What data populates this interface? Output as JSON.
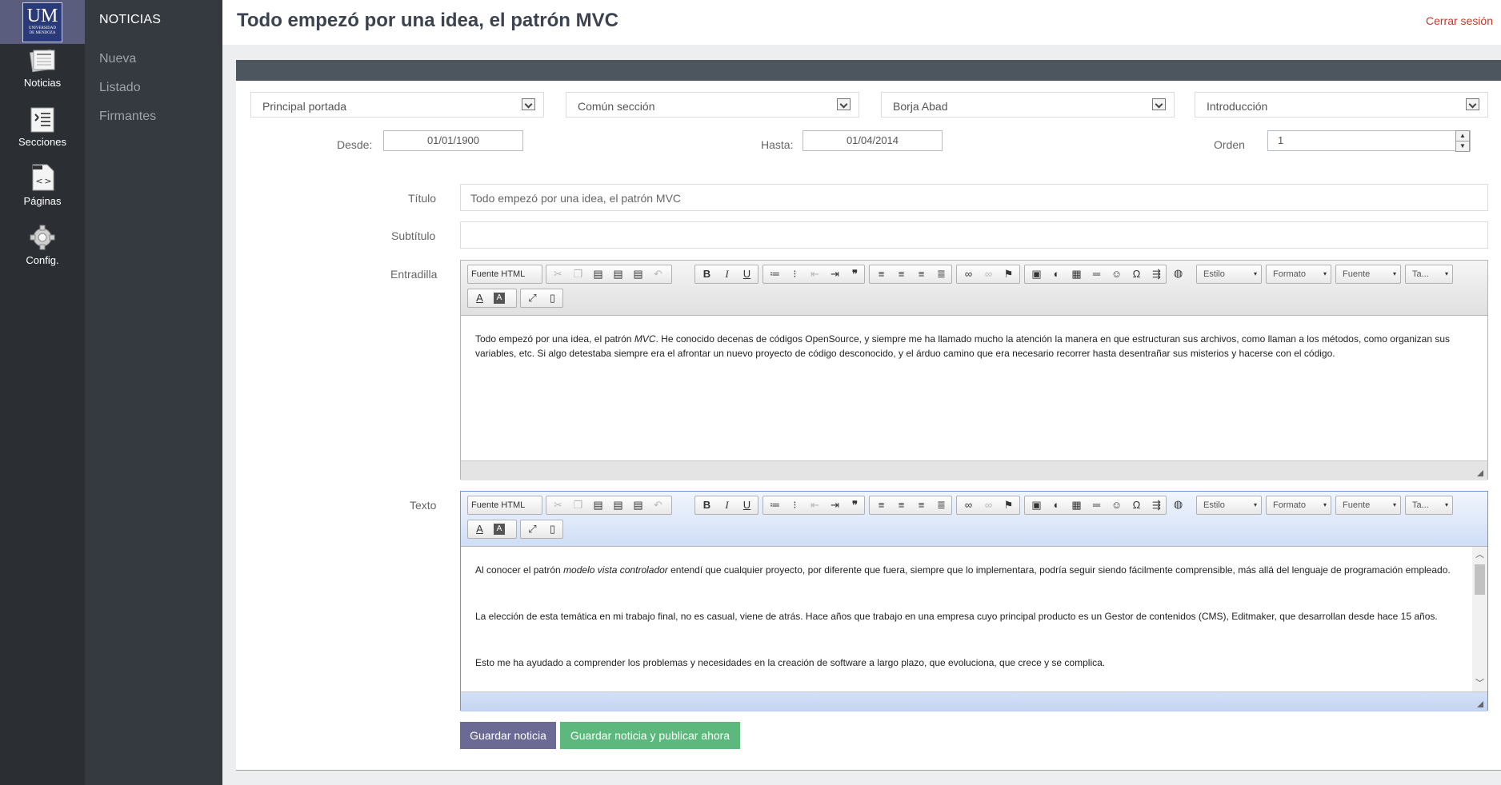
{
  "logo": {
    "big": "UM",
    "small1": "UNIVERSIDAD",
    "small2": "DE MENDOZA"
  },
  "nav": [
    {
      "label": "Noticias",
      "icon": "newspaper-icon"
    },
    {
      "label": "Secciones",
      "icon": "list-icon"
    },
    {
      "label": "Páginas",
      "icon": "html-page-icon"
    },
    {
      "label": "Config.",
      "icon": "gear-icon"
    }
  ],
  "submenu": {
    "title": "NOTICIAS",
    "links": [
      "Nueva",
      "Listado",
      "Firmantes"
    ]
  },
  "header": {
    "title": "Todo empezó por una idea, el patrón MVC",
    "logout": "Cerrar sesión"
  },
  "form": {
    "selects": [
      "Principal portada",
      "Común sección",
      "Borja Abad",
      "Introducción"
    ],
    "desde_label": "Desde:",
    "desde_value": "01/01/1900",
    "hasta_label": "Hasta:",
    "hasta_value": "01/04/2014",
    "orden_label": "Orden",
    "orden_value": "1",
    "titulo_label": "Título",
    "titulo_value": "Todo empezó por una idea, el patrón MVC",
    "subtitulo_label": "Subtítulo",
    "subtitulo_value": "",
    "entradilla_label": "Entradilla",
    "texto_label": "Texto"
  },
  "toolbar": {
    "source": "Fuente HTML",
    "combos": [
      "Estilo",
      "Formato",
      "Fuente",
      "Ta..."
    ]
  },
  "entradilla": {
    "p1a": "Todo empezó por una idea, el patrón ",
    "p1b": "MVC",
    "p1c": ". He conocido decenas de códigos OpenSource, y siempre me ha llamado mucho la atención la manera en que estructuran sus archivos, como llaman a los métodos, como organizan sus variables, etc.  Si algo detestaba siempre era el afrontar un nuevo proyecto de código desconocido, y el árduo camino que era necesario recorrer hasta desentrañar sus misterios y hacerse con el código."
  },
  "texto": {
    "p1a": "Al conocer el patrón  ",
    "p1b": "modelo vista controlador",
    "p1c": " entendí que cualquier proyecto, por diferente que fuera, siempre que lo implementara, podría seguir siendo fácilmente comprensible, más allá del lenguaje de programación empleado.",
    "p2": "La elección de esta temática en mi trabajo final, no es casual, viene de atrás. Hace años que trabajo en una empresa cuyo principal producto es un Gestor de contenidos (CMS), Editmaker, que desarrollan desde hace 15 años.",
    "p3": "Esto me ha ayudado a comprender los problemas y necesidades en la creación de software a largo plazo, que evoluciona, que crece y se complica."
  },
  "buttons": {
    "save": "Guardar noticia",
    "publish": "Guardar noticia y publicar ahora"
  },
  "colors": {
    "save": "#6b6a94",
    "publish": "#5cb87d",
    "logout": "#c0392b"
  }
}
